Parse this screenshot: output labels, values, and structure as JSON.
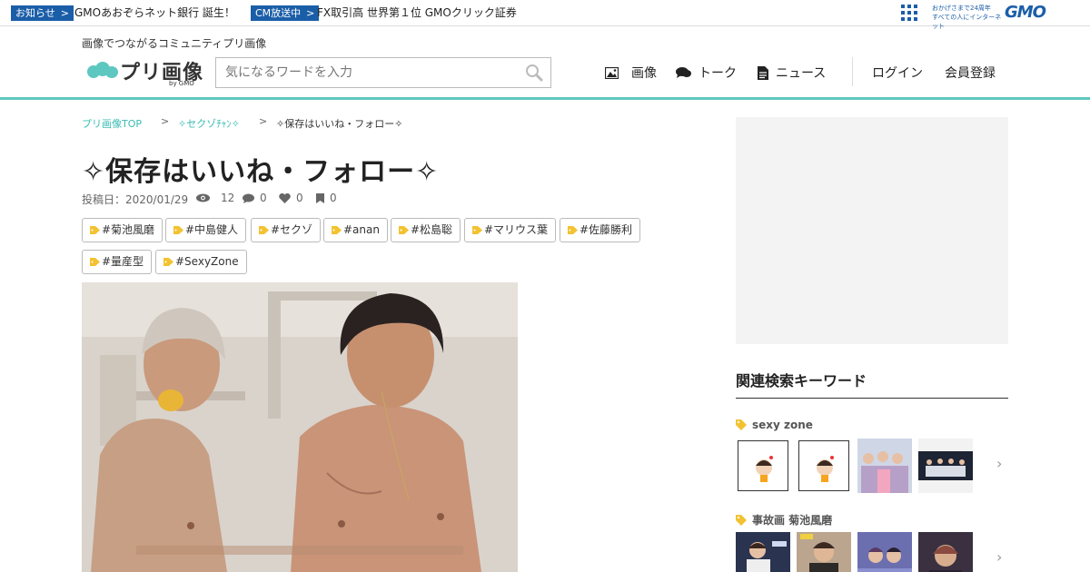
{
  "gmo_bar": {
    "badge1": "お知らせ",
    "badge1_arrow": ">",
    "text1": "GMOあおぞらネット銀行 誕生！",
    "badge2": "CM放送中",
    "badge2_arrow": ">",
    "text2": "FX取引高 世界第１位 GMOクリック証券",
    "tagline_line1": "おかげさまで24周年",
    "tagline_line2": "すべての人にインターネット",
    "logo": "GMO"
  },
  "header": {
    "tagline": "画像でつながるコミュニティプリ画像",
    "logo_text": "プリ画像",
    "logo_sub": "by GMO",
    "search_placeholder": "気になるワードを入力",
    "nav": {
      "images": "画像",
      "talk": "トーク",
      "news": "ニュース",
      "login": "ログイン",
      "register": "会員登録"
    }
  },
  "breadcrumb": {
    "home": "プリ画像TOP",
    "sep": ">",
    "category": "✧セクゾﾁｬﾝ✧",
    "current": "✧保存はいいね・フォロー✧"
  },
  "post": {
    "title": "✧保存はいいね・フォロー✧",
    "date_label": "投稿日：2020/01/29",
    "views": "12",
    "comments": "0",
    "likes": "0",
    "saves": "0",
    "tags": [
      "#菊池風磨",
      "#中島健人",
      "#セクゾ",
      "#anan",
      "#松島聡",
      "#マリウス葉",
      "#佐藤勝利",
      "#量産型",
      "#SexyZone"
    ]
  },
  "sidebar": {
    "related_title": "関連検索キーワード",
    "keywords": [
      {
        "label": "sexy zone"
      },
      {
        "label": "事故画 菊池風磨"
      }
    ],
    "chevron": "›"
  },
  "colors": {
    "accent": "#5ec8c0",
    "link": "#3bbcb3",
    "gmo_blue": "#1b5ea8",
    "tag_icon": "#f2c230"
  }
}
